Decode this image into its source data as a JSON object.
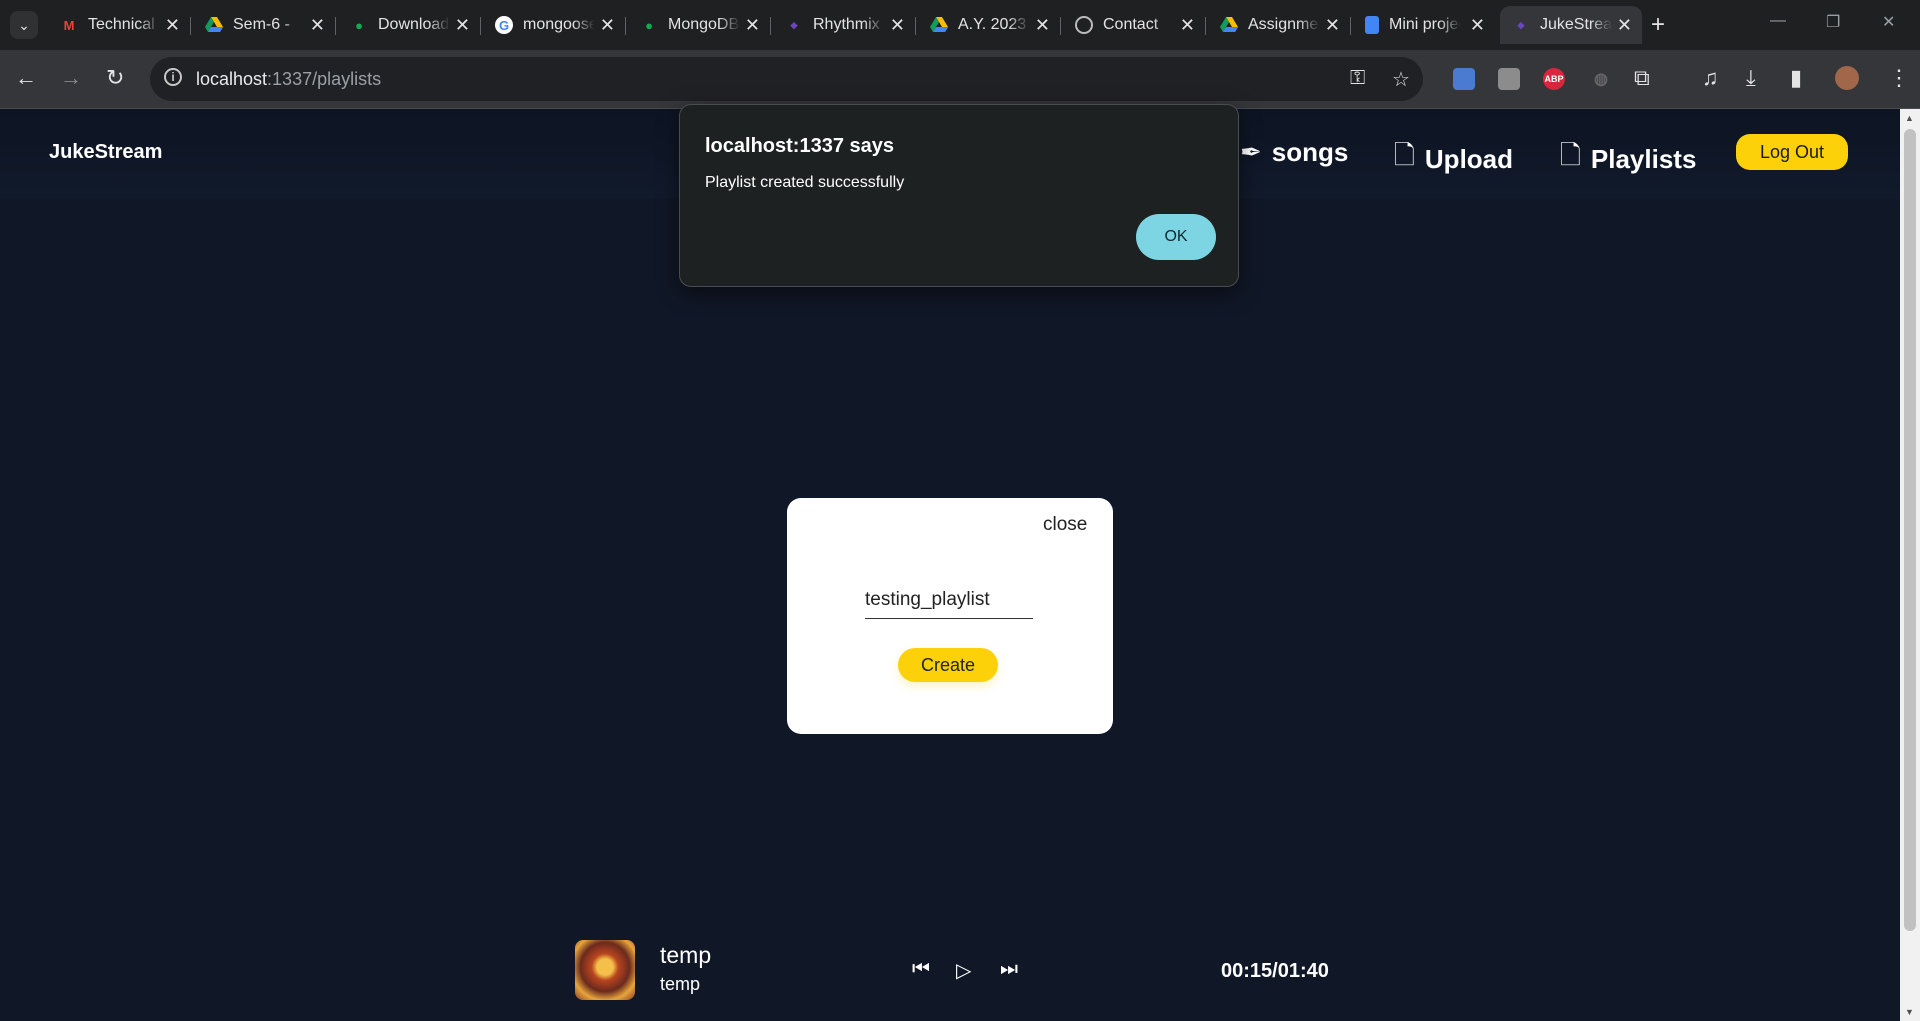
{
  "browser": {
    "tabs": [
      {
        "label": "Technical",
        "icon": "gmail-icon"
      },
      {
        "label": "Sem-6 -",
        "icon": "drive-icon"
      },
      {
        "label": "Download",
        "icon": "mongodb-icon"
      },
      {
        "label": "mongoose",
        "icon": "google-icon"
      },
      {
        "label": "MongoDB",
        "icon": "mongodb-icon"
      },
      {
        "label": "Rhythmix",
        "icon": "site-icon"
      },
      {
        "label": "A.Y. 2023",
        "icon": "drive-icon"
      },
      {
        "label": "Contact",
        "icon": "globe-icon"
      },
      {
        "label": "Assignment",
        "icon": "drive-icon"
      },
      {
        "label": "Mini project",
        "icon": "docs-icon"
      },
      {
        "label": "JukeStream",
        "icon": "site-icon",
        "active": true
      }
    ],
    "url_host": "localhost",
    "url_path": ":1337/playlists"
  },
  "app": {
    "brand": "JukeStream",
    "nav": {
      "songs": "songs",
      "upload": "Upload",
      "playlists": "Playlists",
      "logout": "Log Out"
    },
    "accent": "#fcd109",
    "background": "#101726"
  },
  "modal": {
    "close_label": "close",
    "playlist_name": "testing_playlist",
    "create_label": "Create"
  },
  "player": {
    "title": "temp",
    "artist": "temp",
    "time": "00:15/01:40"
  },
  "alert": {
    "title": "localhost:1337 says",
    "message": "Playlist created successfully",
    "ok_label": "OK"
  }
}
